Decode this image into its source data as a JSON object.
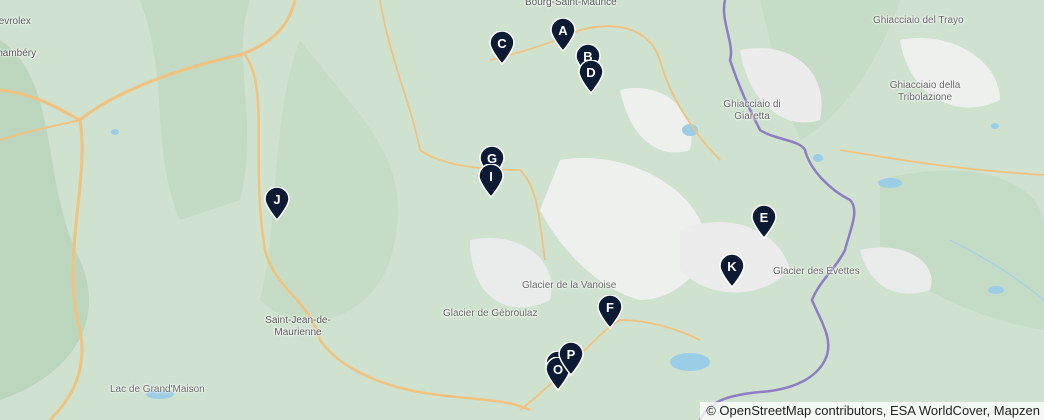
{
  "map": {
    "place_labels": [
      {
        "id": "bourg",
        "text": "Bourg-Saint-Maurice"
      },
      {
        "id": "chambery",
        "text": "Chambéry"
      },
      {
        "id": "sevrolex",
        "text": "Sevrolex"
      },
      {
        "id": "ghiacciaio_trayo",
        "text": "Ghiacciaio del Trayo"
      },
      {
        "id": "ghiacciaio_giaretta",
        "text": "Ghiacciaio di Giaretta"
      },
      {
        "id": "ghiacciaio_tribolazione",
        "text": "Ghiacciaio della Tribolazione"
      },
      {
        "id": "glacier_vanoise",
        "text": "Glacier de la Vanoise"
      },
      {
        "id": "glacier_gebroulaz",
        "text": "Glacier de Gébroulaz"
      },
      {
        "id": "glacier_evettes",
        "text": "Glacier des Évettes"
      },
      {
        "id": "saint_jean",
        "text": "Saint-Jean-de-Maurienne"
      },
      {
        "id": "lac_grand_maison",
        "text": "Lac de Grand'Maison"
      }
    ],
    "markers": [
      {
        "letter": "A"
      },
      {
        "letter": "B"
      },
      {
        "letter": "C"
      },
      {
        "letter": "D"
      },
      {
        "letter": "E"
      },
      {
        "letter": "F"
      },
      {
        "letter": "G"
      },
      {
        "letter": "I"
      },
      {
        "letter": "J"
      },
      {
        "letter": "K"
      },
      {
        "letter": "Q"
      },
      {
        "letter": "O"
      },
      {
        "letter": "P"
      }
    ],
    "attribution": "© OpenStreetMap contributors, ESA WorldCover, Mapzen",
    "colors": {
      "marker": "#0c1b33",
      "land": "#cfe1cf",
      "snow": "#f3f3f3",
      "road": "#f1c27d",
      "border": "#8f7cc4",
      "water": "#9ccde6"
    }
  }
}
